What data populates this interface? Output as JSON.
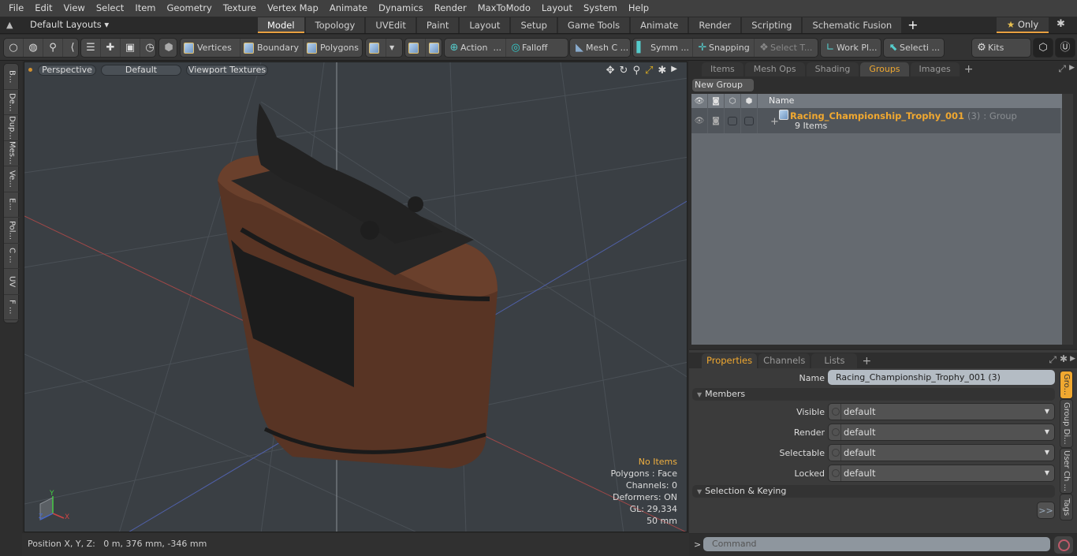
{
  "menubar": {
    "items": [
      "File",
      "Edit",
      "View",
      "Select",
      "Item",
      "Geometry",
      "Texture",
      "Vertex Map",
      "Animate",
      "Dynamics",
      "Render",
      "MaxToModo",
      "Layout",
      "System",
      "Help"
    ]
  },
  "layoutbar": {
    "layouts_label": "Default Layouts",
    "tabs": [
      "Model",
      "Topology",
      "UVEdit",
      "Paint",
      "Layout",
      "Setup",
      "Game Tools",
      "Animate",
      "Render",
      "Scripting",
      "Schematic Fusion"
    ],
    "active_tab": "Model",
    "only_label": "Only"
  },
  "toolbar": {
    "vertices": "Vertices",
    "boundary": "Boundary",
    "polygons": "Polygons",
    "action": "Action",
    "action_more": "...",
    "falloff": "Falloff",
    "mesh_c": "Mesh C ...",
    "symm": "Symm ...",
    "snapping": "Snapping",
    "select_t": "Select T...",
    "work_pl": "Work Pl...",
    "selecti": "Selecti ...",
    "kits": "Kits"
  },
  "left_strip": [
    "B...",
    "De...",
    "Dup...",
    "Mes...",
    "Ve...",
    "E...",
    "Pol...",
    "C ...",
    "UV",
    "F ..."
  ],
  "viewport": {
    "view_mode": "Perspective",
    "shading": "Default",
    "textures": "Viewport Textures",
    "info": {
      "selection": "No Items",
      "polygons": "Polygons : Face",
      "channels": "Channels: 0",
      "deformers": "Deformers: ON",
      "gl": "GL: 29,334",
      "scale": "50 mm"
    },
    "axis": {
      "x": "X",
      "y": "Y",
      "z": "Z"
    }
  },
  "statusbar": {
    "position": "Position X, Y, Z:   0 m, 376 mm, -346 mm"
  },
  "groups_panel": {
    "tabs": [
      "Items",
      "Mesh Ops",
      "Shading",
      "Groups",
      "Images"
    ],
    "active_tab": "Groups",
    "new_group": "New Group",
    "column_name": "Name",
    "group": {
      "name": "Racing_Championship_Trophy_001",
      "count": "(3)",
      "type": ": Group",
      "items": "9 Items"
    }
  },
  "properties_panel": {
    "tabs": [
      "Properties",
      "Channels",
      "Lists"
    ],
    "active_tab": "Properties",
    "name_label": "Name",
    "name_value": "Racing_Championship_Trophy_001 (3)",
    "members_section": "Members",
    "fields": [
      {
        "label": "Visible",
        "value": "default"
      },
      {
        "label": "Render",
        "value": "default"
      },
      {
        "label": "Selectable",
        "value": "default"
      },
      {
        "label": "Locked",
        "value": "default"
      }
    ],
    "selection_section": "Selection & Keying",
    "more_label": ">>",
    "side_tabs": [
      "Gro...",
      "Group Di...",
      "User Ch ...",
      "Tags"
    ]
  },
  "command": {
    "prompt": ">",
    "placeholder": "Command"
  },
  "colors": {
    "accent": "#f0a830",
    "viewport_bg": "#3a3f44",
    "wood": "#5a3626"
  }
}
